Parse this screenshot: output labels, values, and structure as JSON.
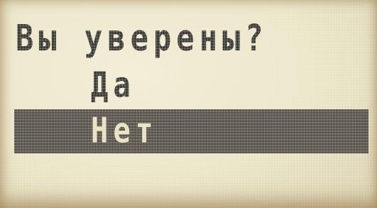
{
  "dialog": {
    "prompt": "Вы уверены?",
    "options": [
      {
        "label": "Да",
        "selected": false
      },
      {
        "label": "Нет",
        "selected": true
      }
    ]
  }
}
